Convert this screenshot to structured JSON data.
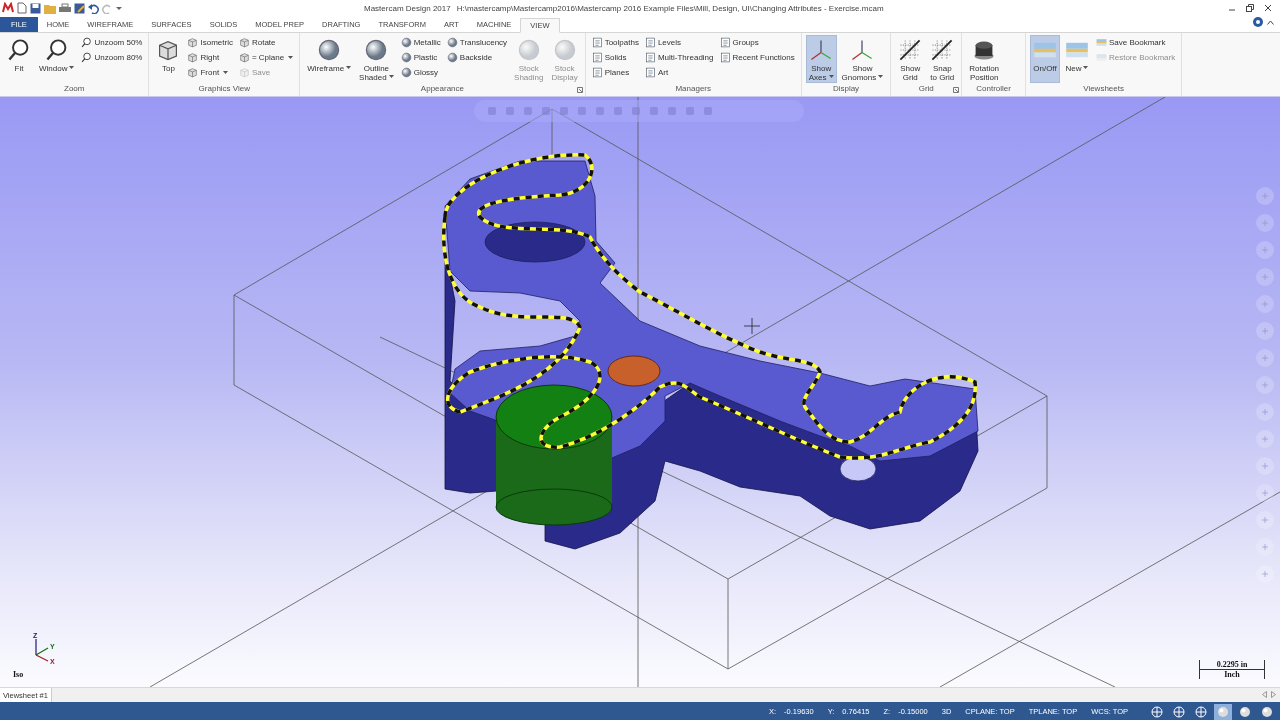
{
  "window": {
    "app_name": "Mastercam Design 2017",
    "file_path": "H:\\mastercamp\\Mastercamp2016\\Mastercamp 2016 Example Files\\Mill, Design, UI\\Changing Attributes - Exercise.mcam"
  },
  "tabs": [
    {
      "label": "FILE",
      "kind": "file",
      "selected": false
    },
    {
      "label": "HOME",
      "kind": "tab",
      "selected": false
    },
    {
      "label": "WIREFRAME",
      "kind": "tab",
      "selected": false
    },
    {
      "label": "SURFACES",
      "kind": "tab",
      "selected": false
    },
    {
      "label": "SOLIDS",
      "kind": "tab",
      "selected": false
    },
    {
      "label": "MODEL PREP",
      "kind": "tab",
      "selected": false
    },
    {
      "label": "DRAFTING",
      "kind": "tab",
      "selected": false
    },
    {
      "label": "TRANSFORM",
      "kind": "tab",
      "selected": false
    },
    {
      "label": "ART",
      "kind": "tab",
      "selected": false
    },
    {
      "label": "MACHINE",
      "kind": "tab",
      "selected": false
    },
    {
      "label": "VIEW",
      "kind": "tab",
      "selected": true
    }
  ],
  "ribbon": {
    "groups": [
      {
        "label": "Zoom",
        "launcher": false,
        "columns": [
          {
            "kind": "large",
            "label": "Fit",
            "dropdown": false,
            "disabled": false,
            "selected": false
          },
          {
            "kind": "large",
            "label": "Window",
            "dropdown": true,
            "disabled": false,
            "selected": false
          },
          {
            "kind": "stack",
            "items": [
              {
                "label": "Unzoom 50%",
                "dropdown": false,
                "disabled": false
              },
              {
                "label": "Unzoom 80%",
                "dropdown": false,
                "disabled": false
              }
            ]
          }
        ]
      },
      {
        "label": "Graphics View",
        "launcher": false,
        "columns": [
          {
            "kind": "large",
            "label": "Top",
            "dropdown": false,
            "disabled": false,
            "selected": false
          },
          {
            "kind": "stack",
            "items": [
              {
                "label": "Isometric",
                "dropdown": false,
                "disabled": false
              },
              {
                "label": "Right",
                "dropdown": false,
                "disabled": false
              },
              {
                "label": "Front",
                "dropdown": true,
                "disabled": false
              }
            ]
          },
          {
            "kind": "stack",
            "items": [
              {
                "label": "Rotate",
                "dropdown": false,
                "disabled": false
              },
              {
                "label": "= Cplane",
                "dropdown": true,
                "disabled": false
              },
              {
                "label": "Save",
                "dropdown": false,
                "disabled": true
              }
            ]
          }
        ]
      },
      {
        "label": "Appearance",
        "launcher": true,
        "columns": [
          {
            "kind": "large",
            "label": "Wireframe",
            "dropdown": true,
            "disabled": false,
            "selected": false
          },
          {
            "kind": "large",
            "label": "Outline\nShaded",
            "dropdown": true,
            "disabled": false,
            "selected": false
          },
          {
            "kind": "stack",
            "items": [
              {
                "label": "Metallic",
                "dropdown": false,
                "disabled": false
              },
              {
                "label": "Plastic",
                "dropdown": false,
                "disabled": false
              },
              {
                "label": "Glossy",
                "dropdown": false,
                "disabled": false
              }
            ]
          },
          {
            "kind": "stack",
            "items": [
              {
                "label": "Translucency",
                "dropdown": false,
                "disabled": false
              },
              {
                "label": "Backside",
                "dropdown": false,
                "disabled": false
              }
            ]
          },
          {
            "kind": "large",
            "label": "Stock\nShading",
            "dropdown": false,
            "disabled": true,
            "selected": false
          },
          {
            "kind": "large",
            "label": "Stock\nDisplay",
            "dropdown": false,
            "disabled": true,
            "selected": false
          }
        ]
      },
      {
        "label": "Managers",
        "launcher": false,
        "columns": [
          {
            "kind": "stack",
            "items": [
              {
                "label": "Toolpaths",
                "dropdown": false,
                "disabled": false
              },
              {
                "label": "Solids",
                "dropdown": false,
                "disabled": false
              },
              {
                "label": "Planes",
                "dropdown": false,
                "disabled": false
              }
            ]
          },
          {
            "kind": "stack",
            "items": [
              {
                "label": "Levels",
                "dropdown": false,
                "disabled": false
              },
              {
                "label": "Multi-Threading",
                "dropdown": false,
                "disabled": false
              },
              {
                "label": "Art",
                "dropdown": false,
                "disabled": false
              }
            ]
          },
          {
            "kind": "stack",
            "items": [
              {
                "label": "Groups",
                "dropdown": false,
                "disabled": false
              },
              {
                "label": "Recent Functions",
                "dropdown": false,
                "disabled": false
              }
            ]
          }
        ]
      },
      {
        "label": "Display",
        "launcher": false,
        "columns": [
          {
            "kind": "large",
            "label": "Show\nAxes",
            "dropdown": true,
            "disabled": false,
            "selected": true
          },
          {
            "kind": "large",
            "label": "Show\nGnomons",
            "dropdown": true,
            "disabled": false,
            "selected": false
          }
        ]
      },
      {
        "label": "Grid",
        "launcher": true,
        "columns": [
          {
            "kind": "large",
            "label": "Show\nGrid",
            "dropdown": false,
            "disabled": false,
            "selected": false
          },
          {
            "kind": "large",
            "label": "Snap\nto Grid",
            "dropdown": false,
            "disabled": false,
            "selected": false
          }
        ]
      },
      {
        "label": "Controller",
        "launcher": false,
        "columns": [
          {
            "kind": "large",
            "label": "Rotation\nPosition",
            "dropdown": false,
            "disabled": false,
            "selected": false
          }
        ]
      },
      {
        "label": "Viewsheets",
        "launcher": false,
        "columns": [
          {
            "kind": "large",
            "label": "On/Off",
            "dropdown": false,
            "disabled": false,
            "selected": true
          },
          {
            "kind": "large",
            "label": "New",
            "dropdown": true,
            "disabled": false,
            "selected": false
          },
          {
            "kind": "stack",
            "items": [
              {
                "label": "Save Bookmark",
                "dropdown": false,
                "disabled": false
              },
              {
                "label": "Restore Bookmark",
                "dropdown": false,
                "disabled": true
              }
            ]
          }
        ]
      }
    ]
  },
  "viewport": {
    "view_name": "Iso",
    "triad": {
      "z": "Z",
      "y": "Y",
      "x": "X"
    },
    "scale": {
      "value": "0.2295 in",
      "unit": "Inch"
    }
  },
  "viewsheets": [
    {
      "label": "Viewsheet #1",
      "selected": true
    }
  ],
  "status_bar": {
    "coordinates": [
      {
        "label": "X:",
        "value": "-0.19630"
      },
      {
        "label": "Y:",
        "value": "0.76415"
      },
      {
        "label": "Z:",
        "value": "-0.15000"
      }
    ],
    "fields": [
      "3D",
      "CPLANE: TOP",
      "TPLANE: TOP",
      "WCS: TOP"
    ],
    "display_modes": [
      {
        "kind": "globe",
        "selected": false
      },
      {
        "kind": "globe",
        "selected": false
      },
      {
        "kind": "globe",
        "selected": false
      },
      {
        "kind": "sphere",
        "selected": true
      },
      {
        "kind": "sphere",
        "selected": false
      },
      {
        "kind": "sphere",
        "selected": false
      }
    ]
  }
}
